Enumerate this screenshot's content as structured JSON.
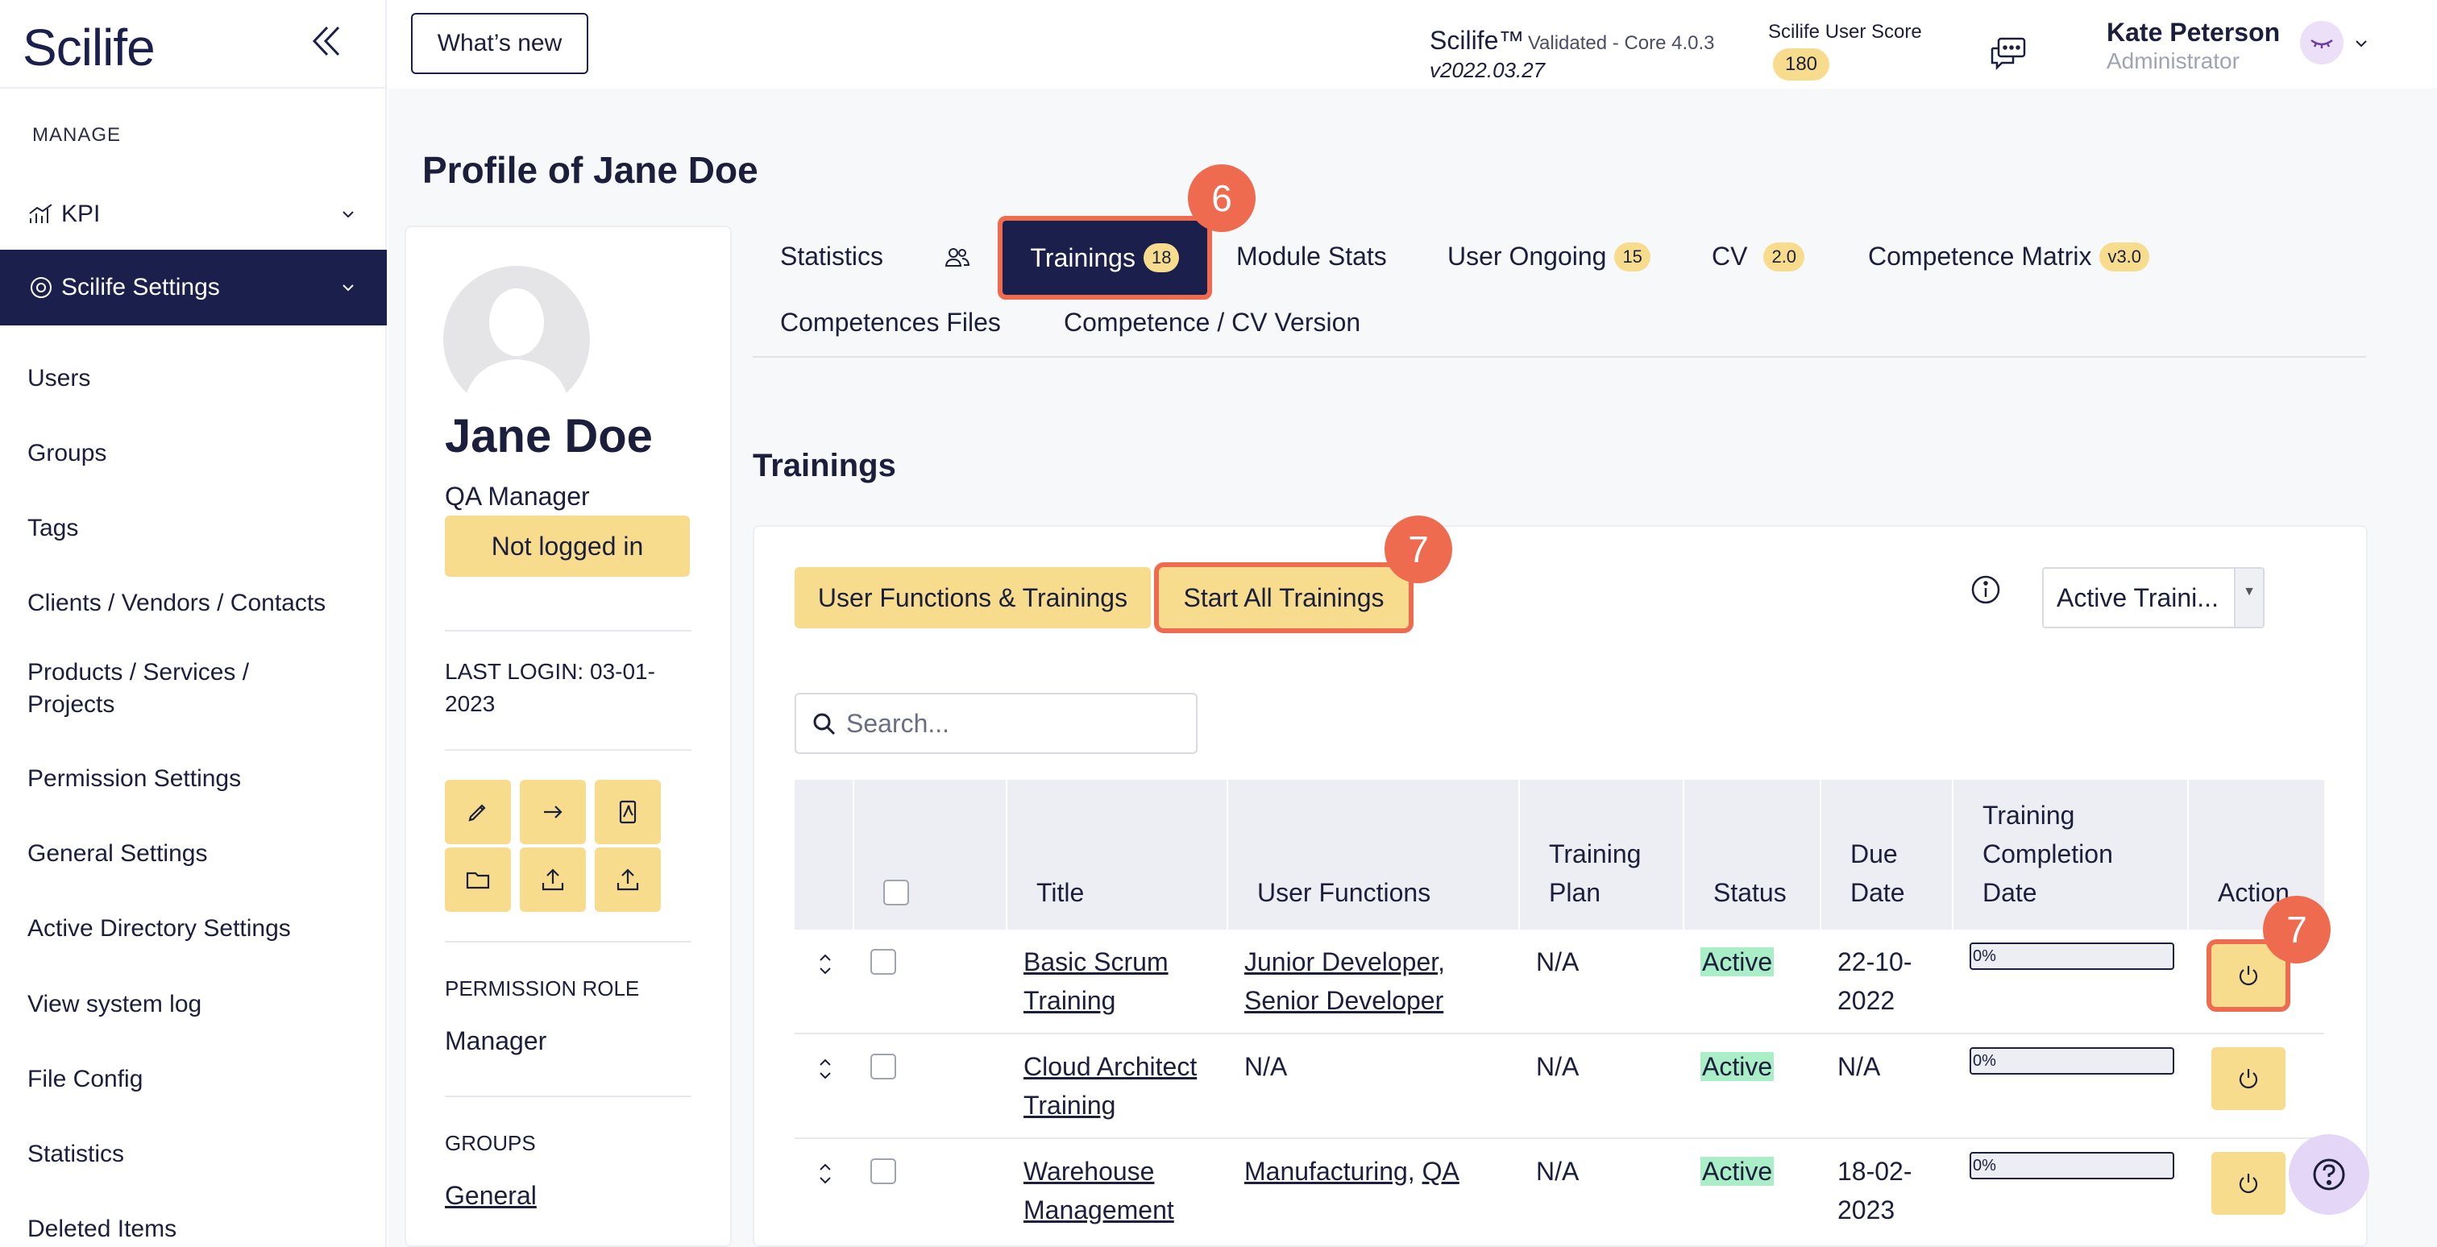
{
  "sidebar": {
    "logo": "Scilife",
    "section_label": "MANAGE",
    "kpi_label": "KPI",
    "settings_label": "Scilife Settings",
    "items": [
      {
        "label": "Users"
      },
      {
        "label": "Groups"
      },
      {
        "label": "Tags"
      },
      {
        "label": "Clients / Vendors / Contacts"
      },
      {
        "label": "Products / Services / Projects"
      },
      {
        "label": "Permission Settings"
      },
      {
        "label": "General Settings"
      },
      {
        "label": "Active Directory Settings"
      },
      {
        "label": "View system log"
      },
      {
        "label": "File Config"
      },
      {
        "label": "Statistics"
      },
      {
        "label": "Deleted Items"
      }
    ]
  },
  "topbar": {
    "whats_new": "What’s new",
    "product": "Scilife™",
    "validated": "Validated - Core 4.0.3",
    "version": "v2022.03.27",
    "score_label": "Scilife User Score",
    "score_value": "180",
    "user_name": "Kate Peterson",
    "user_role": "Administrator"
  },
  "page": {
    "title": "Profile of Jane Doe"
  },
  "profile": {
    "name": "Jane Doe",
    "role": "QA Manager",
    "login_status": "Not logged in",
    "last_login": "LAST LOGIN: 03-01-2023",
    "permission_label": "PERMISSION ROLE",
    "permission_value": "Manager",
    "groups_label": "GROUPS",
    "groups_value": "General"
  },
  "tabs": {
    "statistics": "Statistics",
    "trainings": "Trainings",
    "trainings_count": "18",
    "module_stats": "Module Stats",
    "user_ongoing": "User Ongoing",
    "user_ongoing_count": "15",
    "cv": "CV",
    "cv_version": "2.0",
    "competence_matrix": "Competence Matrix",
    "competence_matrix_version": "v3.0",
    "competences_files": "Competences Files",
    "competence_cv_version": "Competence / CV Version"
  },
  "markers": {
    "tab_step": "6",
    "start_step": "7",
    "action_step": "7"
  },
  "trainings": {
    "section_title": "Trainings",
    "btn_user_functions": "User Functions & Trainings",
    "btn_start_all": "Start All Trainings",
    "filter_selected": "Active Traini...",
    "search_placeholder": "Search...",
    "columns": {
      "title": "Title",
      "user_functions": "User Functions",
      "training_plan": "Training Plan",
      "status": "Status",
      "due_date": "Due Date",
      "completion": "Training Completion Date",
      "action": "Action"
    },
    "rows": [
      {
        "title": "Basic Scrum Training",
        "user_functions": [
          "Junior Developer",
          "Senior Developer"
        ],
        "training_plan": "N/A",
        "status": "Active",
        "due_date": "22-10-2022",
        "progress": "0%"
      },
      {
        "title": "Cloud Architect Training",
        "user_functions": [],
        "user_functions_text": "N/A",
        "training_plan": "N/A",
        "status": "Active",
        "due_date": "N/A",
        "progress": "0%"
      },
      {
        "title": "Warehouse Management",
        "user_functions": [
          "Manufacturing",
          "QA"
        ],
        "training_plan": "N/A",
        "status": "Active",
        "due_date": "18-02-2023",
        "progress": "0%"
      }
    ]
  },
  "colors": {
    "navy": "#1b1f4b",
    "accent_yellow": "#f7dc8e",
    "highlight": "#ef6b50",
    "status_active": "#a9eec6"
  }
}
